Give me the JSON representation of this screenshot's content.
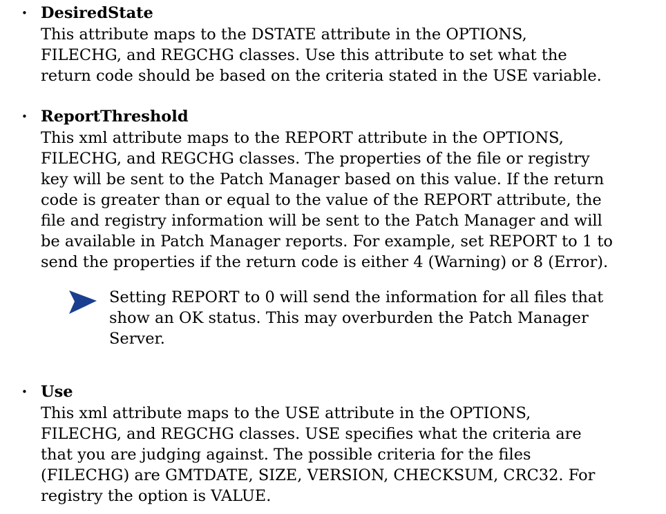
{
  "items": [
    {
      "bullet": "•",
      "term": "DesiredState",
      "lines": [
        "This attribute maps to the DSTATE attribute in the OPTIONS,",
        "FILECHG, and REGCHG classes. Use this attribute to set what the",
        "return code should be based on the criteria stated in the USE variable."
      ]
    },
    {
      "bullet": "•",
      "term": "ReportThreshold",
      "lines": [
        "This xml attribute maps to the REPORT attribute in the OPTIONS,",
        "FILECHG, and REGCHG classes. The properties of the file or registry",
        "key will be sent to the Patch Manager based on this value. If the return",
        "code is greater than or equal to the value of the REPORT attribute, the",
        "file and registry information will be sent to the Patch Manager and will",
        "be available in Patch Manager reports. For example, set REPORT to 1 to",
        "send the properties if the return code is either 4 (Warning) or 8 (Error)."
      ]
    },
    {
      "bullet": "•",
      "term": "Use",
      "lines": [
        "This xml attribute maps to the USE attribute in the OPTIONS,",
        "FILECHG, and REGCHG classes. USE specifies what the criteria are",
        "that you are judging against. The possible criteria for the files",
        "(FILECHG) are GMTDATE, SIZE, VERSION, CHECKSUM, CRC32. For",
        "registry the option is VALUE."
      ]
    }
  ],
  "note": {
    "icon": "note-arrow-icon",
    "icon_color": "#1a3f8f",
    "lines": [
      "Setting REPORT to 0 will send the information for all files that",
      "show an OK status. This may overburden the Patch Manager",
      "Server."
    ]
  }
}
